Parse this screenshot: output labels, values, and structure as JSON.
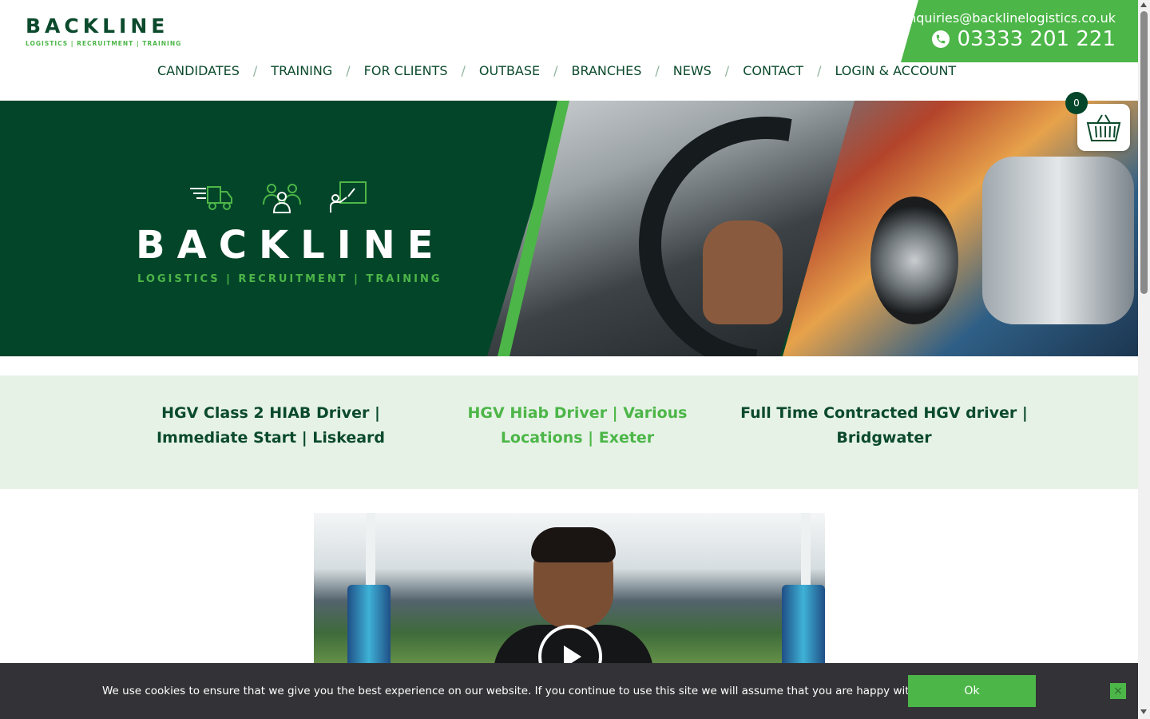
{
  "brand": {
    "name": "BACKLINE",
    "tagline": "LOGISTICS | RECRUITMENT | TRAINING",
    "primary_color": "#0b4a2c",
    "accent_color": "#4cb648"
  },
  "contact": {
    "email": "enquiries@backlinelogistics.co.uk",
    "phone": "03333 201 221",
    "phone_icon": "phone-icon"
  },
  "nav": {
    "items": [
      "CANDIDATES",
      "TRAINING",
      "FOR CLIENTS",
      "OUTBASE",
      "BRANCHES",
      "NEWS",
      "CONTACT",
      "LOGIN & ACCOUNT"
    ],
    "separator": "/"
  },
  "hero": {
    "title": "BACKLINE",
    "subtitle": "LOGISTICS | RECRUITMENT | TRAINING",
    "icons": [
      "truck-icon",
      "people-icon",
      "presentation-icon"
    ]
  },
  "basket": {
    "count": "0",
    "icon": "basket-icon"
  },
  "jobs": [
    {
      "title": "HGV Class 2 HIAB Driver | Immediate Start | Liskeard",
      "active": false
    },
    {
      "title": "HGV Hiab Driver | Various Locations | Exeter",
      "active": true
    },
    {
      "title": "Full Time Contracted HGV driver | Bridgwater",
      "active": false
    }
  ],
  "video": {
    "play_icon": "play-icon"
  },
  "cookie": {
    "message": "We use cookies to ensure that we give you the best experience on our website. If you continue to use this site we will assume that you are happy with it.",
    "ok_label": "Ok",
    "close_icon": "close-icon"
  }
}
